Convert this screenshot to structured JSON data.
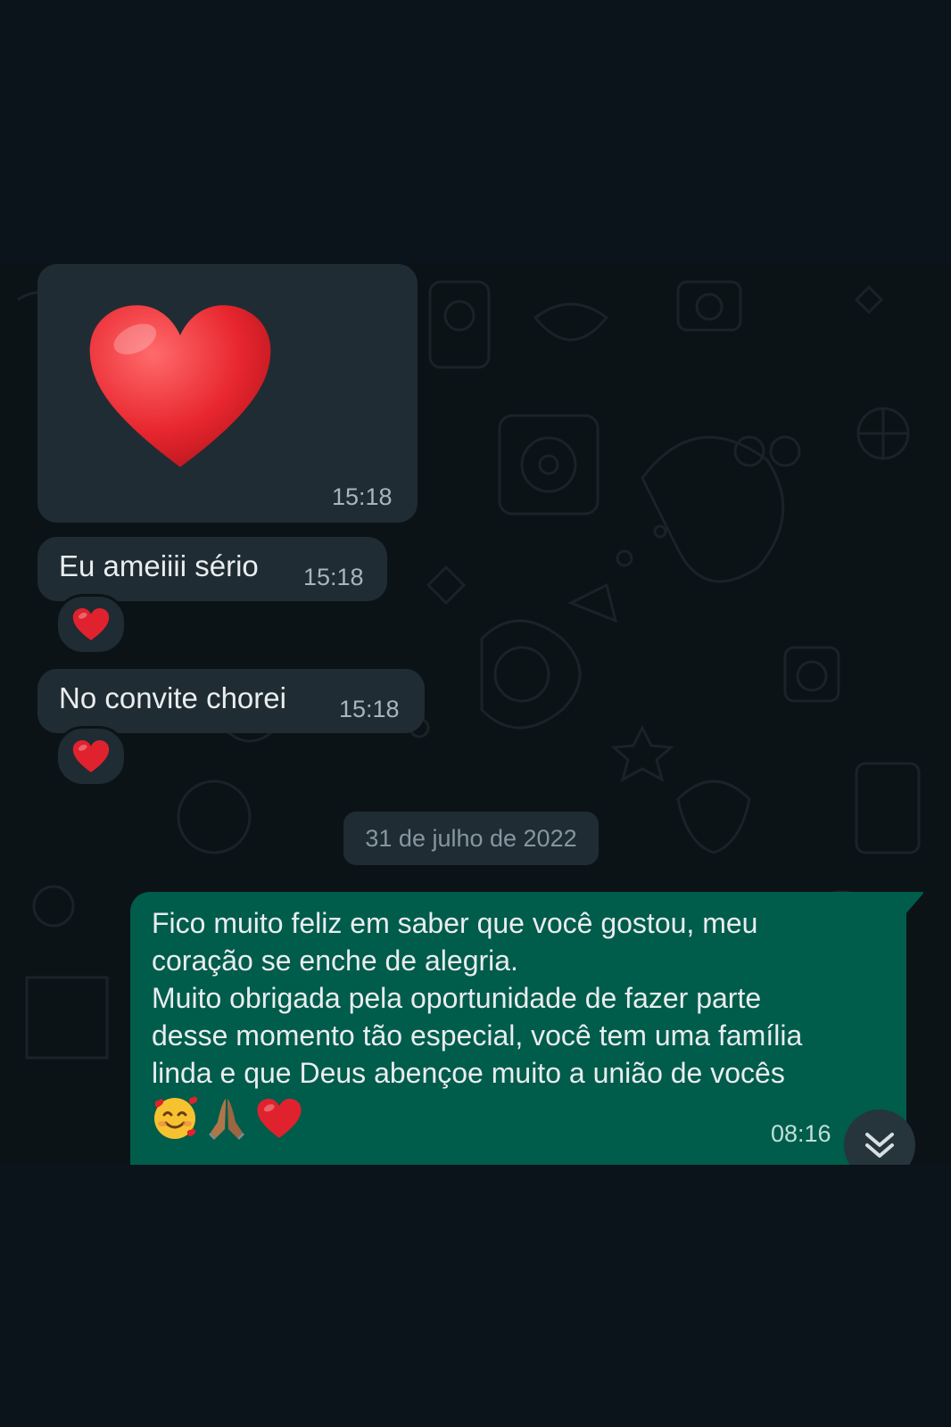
{
  "messages": [
    {
      "type": "sticker",
      "emoji": "heart-emoji",
      "time": "15:18"
    },
    {
      "type": "text",
      "text": "Eu ameiiii sério",
      "time": "15:18",
      "reaction": "heart-emoji"
    },
    {
      "type": "text",
      "text": "No convite chorei",
      "time": "15:18",
      "reaction": "heart-emoji"
    }
  ],
  "date_separator": "31 de julho de 2022",
  "outgoing": {
    "lines": [
      "Fico muito feliz em saber que você gostou, meu",
      "coração se enche de alegria.",
      "Muito obrigada pela oportunidade de fazer parte",
      "desse momento tão especial, você tem uma família",
      "linda e que Deus abençoe muito a união de vocês"
    ],
    "emojis": [
      "smiling-face-with-hearts-emoji",
      "folded-hands-emoji",
      "heart-emoji"
    ],
    "time": "08:16"
  },
  "colors": {
    "background": "#0b141a",
    "incoming_bubble": "#202c33",
    "outgoing_bubble": "#005c4b",
    "heart": "#e0222e"
  },
  "icons": {
    "scroll_down": "double-chevron-down-icon"
  }
}
